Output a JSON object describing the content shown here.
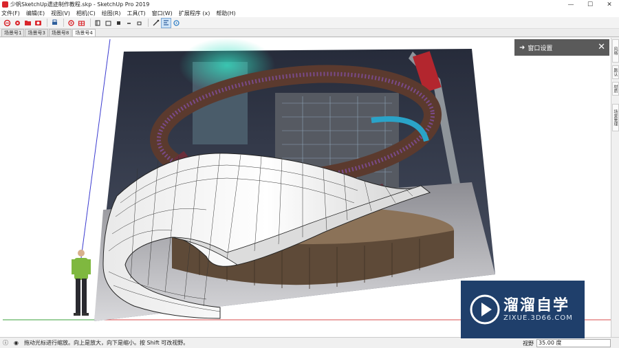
{
  "window": {
    "title": "少帆SketchUp遗迹制作教程.skp - SketchUp Pro 2019",
    "controls": [
      "—",
      "☐",
      "✕"
    ]
  },
  "menu": [
    "文件(F)",
    "编辑(E)",
    "视图(V)",
    "相机(C)",
    "绘图(R)",
    "工具(T)",
    "窗口(W)",
    "扩展程序 (x)",
    "帮助(H)"
  ],
  "toolbar": {
    "icons": [
      "select-icon",
      "eraser-icon",
      "paint-bucket-icon",
      "camera-icon",
      "print-icon",
      "component-icon",
      "warehouse-icon",
      "front-view-icon",
      "back-view-icon",
      "top-view-icon",
      "left-view-icon",
      "right-view-icon",
      "axes-icon",
      "position-camera-icon",
      "walk-icon"
    ],
    "accent": "#d9262c"
  },
  "scenes": [
    "场景号1",
    "场景号3",
    "场景号8",
    "场景号4"
  ],
  "active_scene": "场景号4",
  "tray": {
    "title": "窗口设置",
    "side_tabs": [
      "风格",
      "默认",
      "材质",
      "场景管理"
    ]
  },
  "status": {
    "hint": "拖动光标进行缩放。向上是放大，向下是缩小。按 Shift 可改视野。",
    "measure_label": "视野",
    "measure_value": "35.00 度"
  },
  "watermark": {
    "title": "溜溜自学",
    "subtitle": "ZIXUE.3D66.COM"
  }
}
